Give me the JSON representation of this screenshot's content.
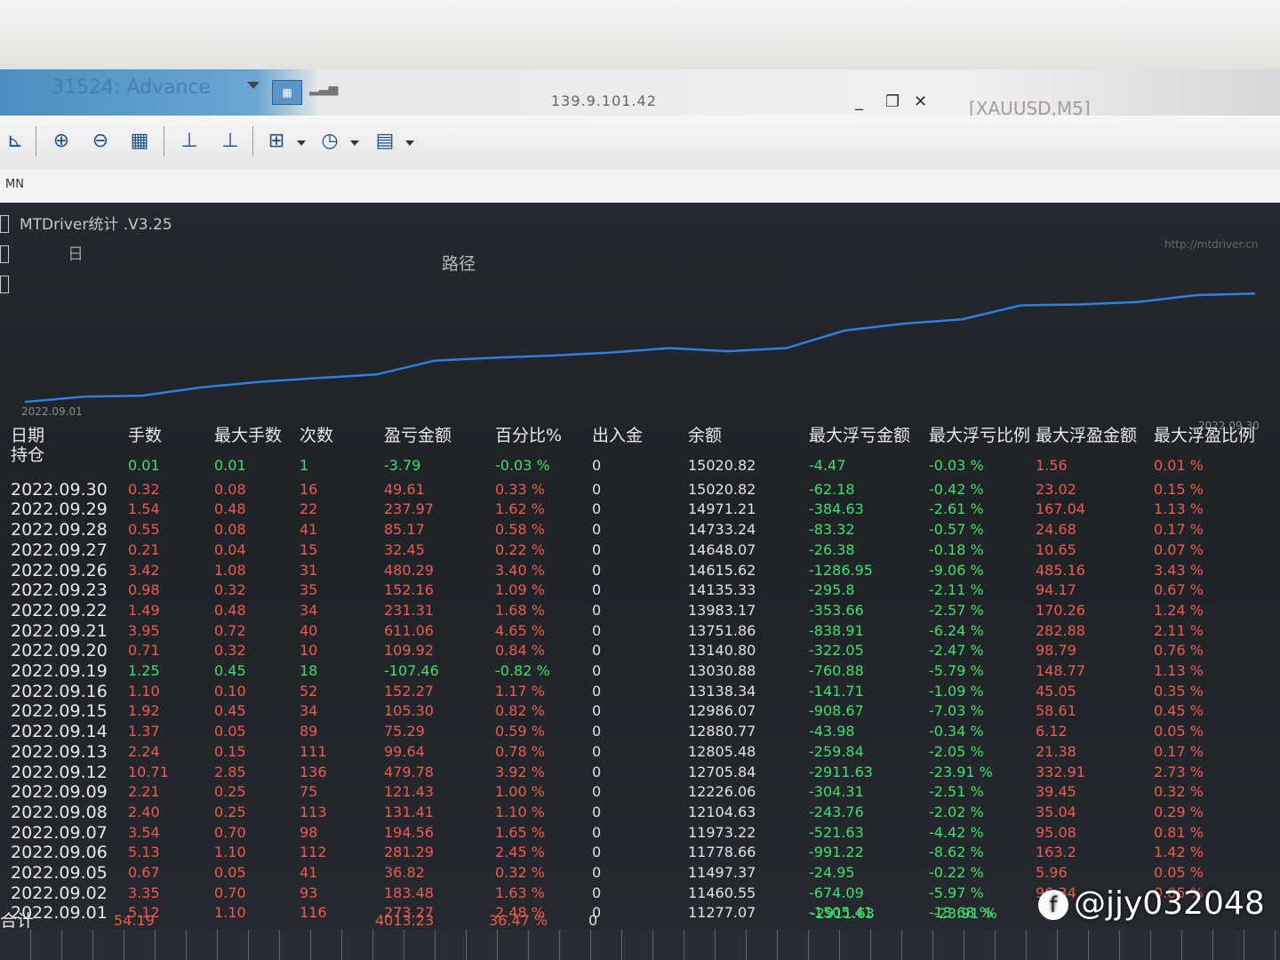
{
  "window": {
    "app_title": "31524: Advance",
    "server_ip": "139.9.101.42",
    "symbol": "[XAUUSD,M5]",
    "minimize_glyph": "_",
    "restore_glyph": "❐",
    "close_glyph": "✕"
  },
  "timeframe_label": "MN",
  "panel": {
    "title": "MTDriver统计 .V3.25",
    "url": "http://mtdriver.cn",
    "ghost_tab": "日",
    "chart_title": "路径",
    "date_start": "2022.09.01",
    "date_end": "2022.09.30"
  },
  "equity_curve": [
    11277.07,
    11460.55,
    11497.37,
    11778.66,
    11973.22,
    12104.63,
    12226.06,
    12705.84,
    12805.48,
    12880.77,
    12986.07,
    13138.34,
    13030.88,
    13140.8,
    13751.86,
    13983.17,
    14135.33,
    14615.62,
    14648.07,
    14733.24,
    14971.21,
    15020.82
  ],
  "headers": [
    "日期",
    "手数",
    "最大手数",
    "次数",
    "盈亏金额",
    "百分比%",
    "出入金",
    "余额",
    "最大浮亏金额",
    "最大浮亏比例",
    "最大浮盈金额",
    "最大浮盈比例"
  ],
  "rows": [
    {
      "date": "持仓",
      "lots": "0.01",
      "max_lots": "0.01",
      "count": "1",
      "pnl": "-3.79",
      "pct": "-0.03 %",
      "deposit": "0",
      "balance": "15020.82",
      "max_dd": "-4.47",
      "max_dd_pct": "-0.03 %",
      "max_fp": "1.56",
      "max_fp_pct": "0.01 %",
      "sign": "neg"
    },
    {
      "date": "2022.09.30",
      "lots": "0.32",
      "max_lots": "0.08",
      "count": "16",
      "pnl": "49.61",
      "pct": "0.33 %",
      "deposit": "0",
      "balance": "15020.82",
      "max_dd": "-62.18",
      "max_dd_pct": "-0.42 %",
      "max_fp": "23.02",
      "max_fp_pct": "0.15 %",
      "sign": "pos"
    },
    {
      "date": "2022.09.29",
      "lots": "1.54",
      "max_lots": "0.48",
      "count": "22",
      "pnl": "237.97",
      "pct": "1.62 %",
      "deposit": "0",
      "balance": "14971.21",
      "max_dd": "-384.63",
      "max_dd_pct": "-2.61 %",
      "max_fp": "167.04",
      "max_fp_pct": "1.13 %",
      "sign": "pos"
    },
    {
      "date": "2022.09.28",
      "lots": "0.55",
      "max_lots": "0.08",
      "count": "41",
      "pnl": "85.17",
      "pct": "0.58 %",
      "deposit": "0",
      "balance": "14733.24",
      "max_dd": "-83.32",
      "max_dd_pct": "-0.57 %",
      "max_fp": "24.68",
      "max_fp_pct": "0.17 %",
      "sign": "pos"
    },
    {
      "date": "2022.09.27",
      "lots": "0.21",
      "max_lots": "0.04",
      "count": "15",
      "pnl": "32.45",
      "pct": "0.22 %",
      "deposit": "0",
      "balance": "14648.07",
      "max_dd": "-26.38",
      "max_dd_pct": "-0.18 %",
      "max_fp": "10.65",
      "max_fp_pct": "0.07 %",
      "sign": "pos"
    },
    {
      "date": "2022.09.26",
      "lots": "3.42",
      "max_lots": "1.08",
      "count": "31",
      "pnl": "480.29",
      "pct": "3.40 %",
      "deposit": "0",
      "balance": "14615.62",
      "max_dd": "-1286.95",
      "max_dd_pct": "-9.06 %",
      "max_fp": "485.16",
      "max_fp_pct": "3.43 %",
      "sign": "pos"
    },
    {
      "date": "2022.09.23",
      "lots": "0.98",
      "max_lots": "0.32",
      "count": "35",
      "pnl": "152.16",
      "pct": "1.09 %",
      "deposit": "0",
      "balance": "14135.33",
      "max_dd": "-295.8",
      "max_dd_pct": "-2.11 %",
      "max_fp": "94.17",
      "max_fp_pct": "0.67 %",
      "sign": "pos"
    },
    {
      "date": "2022.09.22",
      "lots": "1.49",
      "max_lots": "0.48",
      "count": "34",
      "pnl": "231.31",
      "pct": "1.68 %",
      "deposit": "0",
      "balance": "13983.17",
      "max_dd": "-353.66",
      "max_dd_pct": "-2.57 %",
      "max_fp": "170.26",
      "max_fp_pct": "1.24 %",
      "sign": "pos"
    },
    {
      "date": "2022.09.21",
      "lots": "3.95",
      "max_lots": "0.72",
      "count": "40",
      "pnl": "611.06",
      "pct": "4.65 %",
      "deposit": "0",
      "balance": "13751.86",
      "max_dd": "-838.91",
      "max_dd_pct": "-6.24 %",
      "max_fp": "282.88",
      "max_fp_pct": "2.11 %",
      "sign": "pos"
    },
    {
      "date": "2022.09.20",
      "lots": "0.71",
      "max_lots": "0.32",
      "count": "10",
      "pnl": "109.92",
      "pct": "0.84 %",
      "deposit": "0",
      "balance": "13140.80",
      "max_dd": "-322.05",
      "max_dd_pct": "-2.47 %",
      "max_fp": "98.79",
      "max_fp_pct": "0.76 %",
      "sign": "pos"
    },
    {
      "date": "2022.09.19",
      "lots": "1.25",
      "max_lots": "0.45",
      "count": "18",
      "pnl": "-107.46",
      "pct": "-0.82 %",
      "deposit": "0",
      "balance": "13030.88",
      "max_dd": "-760.88",
      "max_dd_pct": "-5.79 %",
      "max_fp": "148.77",
      "max_fp_pct": "1.13 %",
      "sign": "neg"
    },
    {
      "date": "2022.09.16",
      "lots": "1.10",
      "max_lots": "0.10",
      "count": "52",
      "pnl": "152.27",
      "pct": "1.17 %",
      "deposit": "0",
      "balance": "13138.34",
      "max_dd": "-141.71",
      "max_dd_pct": "-1.09 %",
      "max_fp": "45.05",
      "max_fp_pct": "0.35 %",
      "sign": "pos"
    },
    {
      "date": "2022.09.15",
      "lots": "1.92",
      "max_lots": "0.45",
      "count": "34",
      "pnl": "105.30",
      "pct": "0.82 %",
      "deposit": "0",
      "balance": "12986.07",
      "max_dd": "-908.67",
      "max_dd_pct": "-7.03 %",
      "max_fp": "58.61",
      "max_fp_pct": "0.45 %",
      "sign": "pos"
    },
    {
      "date": "2022.09.14",
      "lots": "1.37",
      "max_lots": "0.05",
      "count": "89",
      "pnl": "75.29",
      "pct": "0.59 %",
      "deposit": "0",
      "balance": "12880.77",
      "max_dd": "-43.98",
      "max_dd_pct": "-0.34 %",
      "max_fp": "6.12",
      "max_fp_pct": "0.05 %",
      "sign": "pos"
    },
    {
      "date": "2022.09.13",
      "lots": "2.24",
      "max_lots": "0.15",
      "count": "111",
      "pnl": "99.64",
      "pct": "0.78 %",
      "deposit": "0",
      "balance": "12805.48",
      "max_dd": "-259.84",
      "max_dd_pct": "-2.05 %",
      "max_fp": "21.38",
      "max_fp_pct": "0.17 %",
      "sign": "pos"
    },
    {
      "date": "2022.09.12",
      "lots": "10.71",
      "max_lots": "2.85",
      "count": "136",
      "pnl": "479.78",
      "pct": "3.92 %",
      "deposit": "0",
      "balance": "12705.84",
      "max_dd": "-2911.63",
      "max_dd_pct": "-23.91 %",
      "max_fp": "332.91",
      "max_fp_pct": "2.73 %",
      "sign": "pos"
    },
    {
      "date": "2022.09.09",
      "lots": "2.21",
      "max_lots": "0.25",
      "count": "75",
      "pnl": "121.43",
      "pct": "1.00 %",
      "deposit": "0",
      "balance": "12226.06",
      "max_dd": "-304.31",
      "max_dd_pct": "-2.51 %",
      "max_fp": "39.45",
      "max_fp_pct": "0.32 %",
      "sign": "pos"
    },
    {
      "date": "2022.09.08",
      "lots": "2.40",
      "max_lots": "0.25",
      "count": "113",
      "pnl": "131.41",
      "pct": "1.10 %",
      "deposit": "0",
      "balance": "12104.63",
      "max_dd": "-243.76",
      "max_dd_pct": "-2.02 %",
      "max_fp": "35.04",
      "max_fp_pct": "0.29 %",
      "sign": "pos"
    },
    {
      "date": "2022.09.07",
      "lots": "3.54",
      "max_lots": "0.70",
      "count": "98",
      "pnl": "194.56",
      "pct": "1.65 %",
      "deposit": "0",
      "balance": "11973.22",
      "max_dd": "-521.63",
      "max_dd_pct": "-4.42 %",
      "max_fp": "95.08",
      "max_fp_pct": "0.81 %",
      "sign": "pos"
    },
    {
      "date": "2022.09.06",
      "lots": "5.13",
      "max_lots": "1.10",
      "count": "112",
      "pnl": "281.29",
      "pct": "2.45 %",
      "deposit": "0",
      "balance": "11778.66",
      "max_dd": "-991.22",
      "max_dd_pct": "-8.62 %",
      "max_fp": "163.2",
      "max_fp_pct": "1.42 %",
      "sign": "pos"
    },
    {
      "date": "2022.09.05",
      "lots": "0.67",
      "max_lots": "0.05",
      "count": "41",
      "pnl": "36.82",
      "pct": "0.32 %",
      "deposit": "0",
      "balance": "11497.37",
      "max_dd": "-24.95",
      "max_dd_pct": "-0.22 %",
      "max_fp": "5.96",
      "max_fp_pct": "0.05 %",
      "sign": "pos"
    },
    {
      "date": "2022.09.02",
      "lots": "3.35",
      "max_lots": "0.70",
      "count": "93",
      "pnl": "183.48",
      "pct": "1.63 %",
      "deposit": "0",
      "balance": "11460.55",
      "max_dd": "-674.09",
      "max_dd_pct": "-5.97 %",
      "max_fp": "96.34",
      "max_fp_pct": "0.85 %",
      "sign": "pos"
    },
    {
      "date": "2022.09.01",
      "lots": "5.12",
      "max_lots": "1.10",
      "count": "116",
      "pnl": "273.27",
      "pct": "2.48 %",
      "deposit": "0",
      "balance": "11277.07",
      "max_dd": "-1505.41",
      "max_dd_pct": "-13.68 %",
      "max_fp": "",
      "max_fp_pct": "",
      "sign": "pos"
    }
  ],
  "totals": {
    "label": "合计",
    "lots": "54.19",
    "pnl": "4013.23",
    "pct": "36.47 %",
    "deposit": "0",
    "max_dd": "-2911.63",
    "max_dd_pct": "-23.91 %"
  },
  "watermark": "@jjy032048",
  "colors": {
    "positive": "#f05a4e",
    "negative": "#3fe06a",
    "text": "#e2e2e2",
    "curve": "#2f7ee0"
  }
}
